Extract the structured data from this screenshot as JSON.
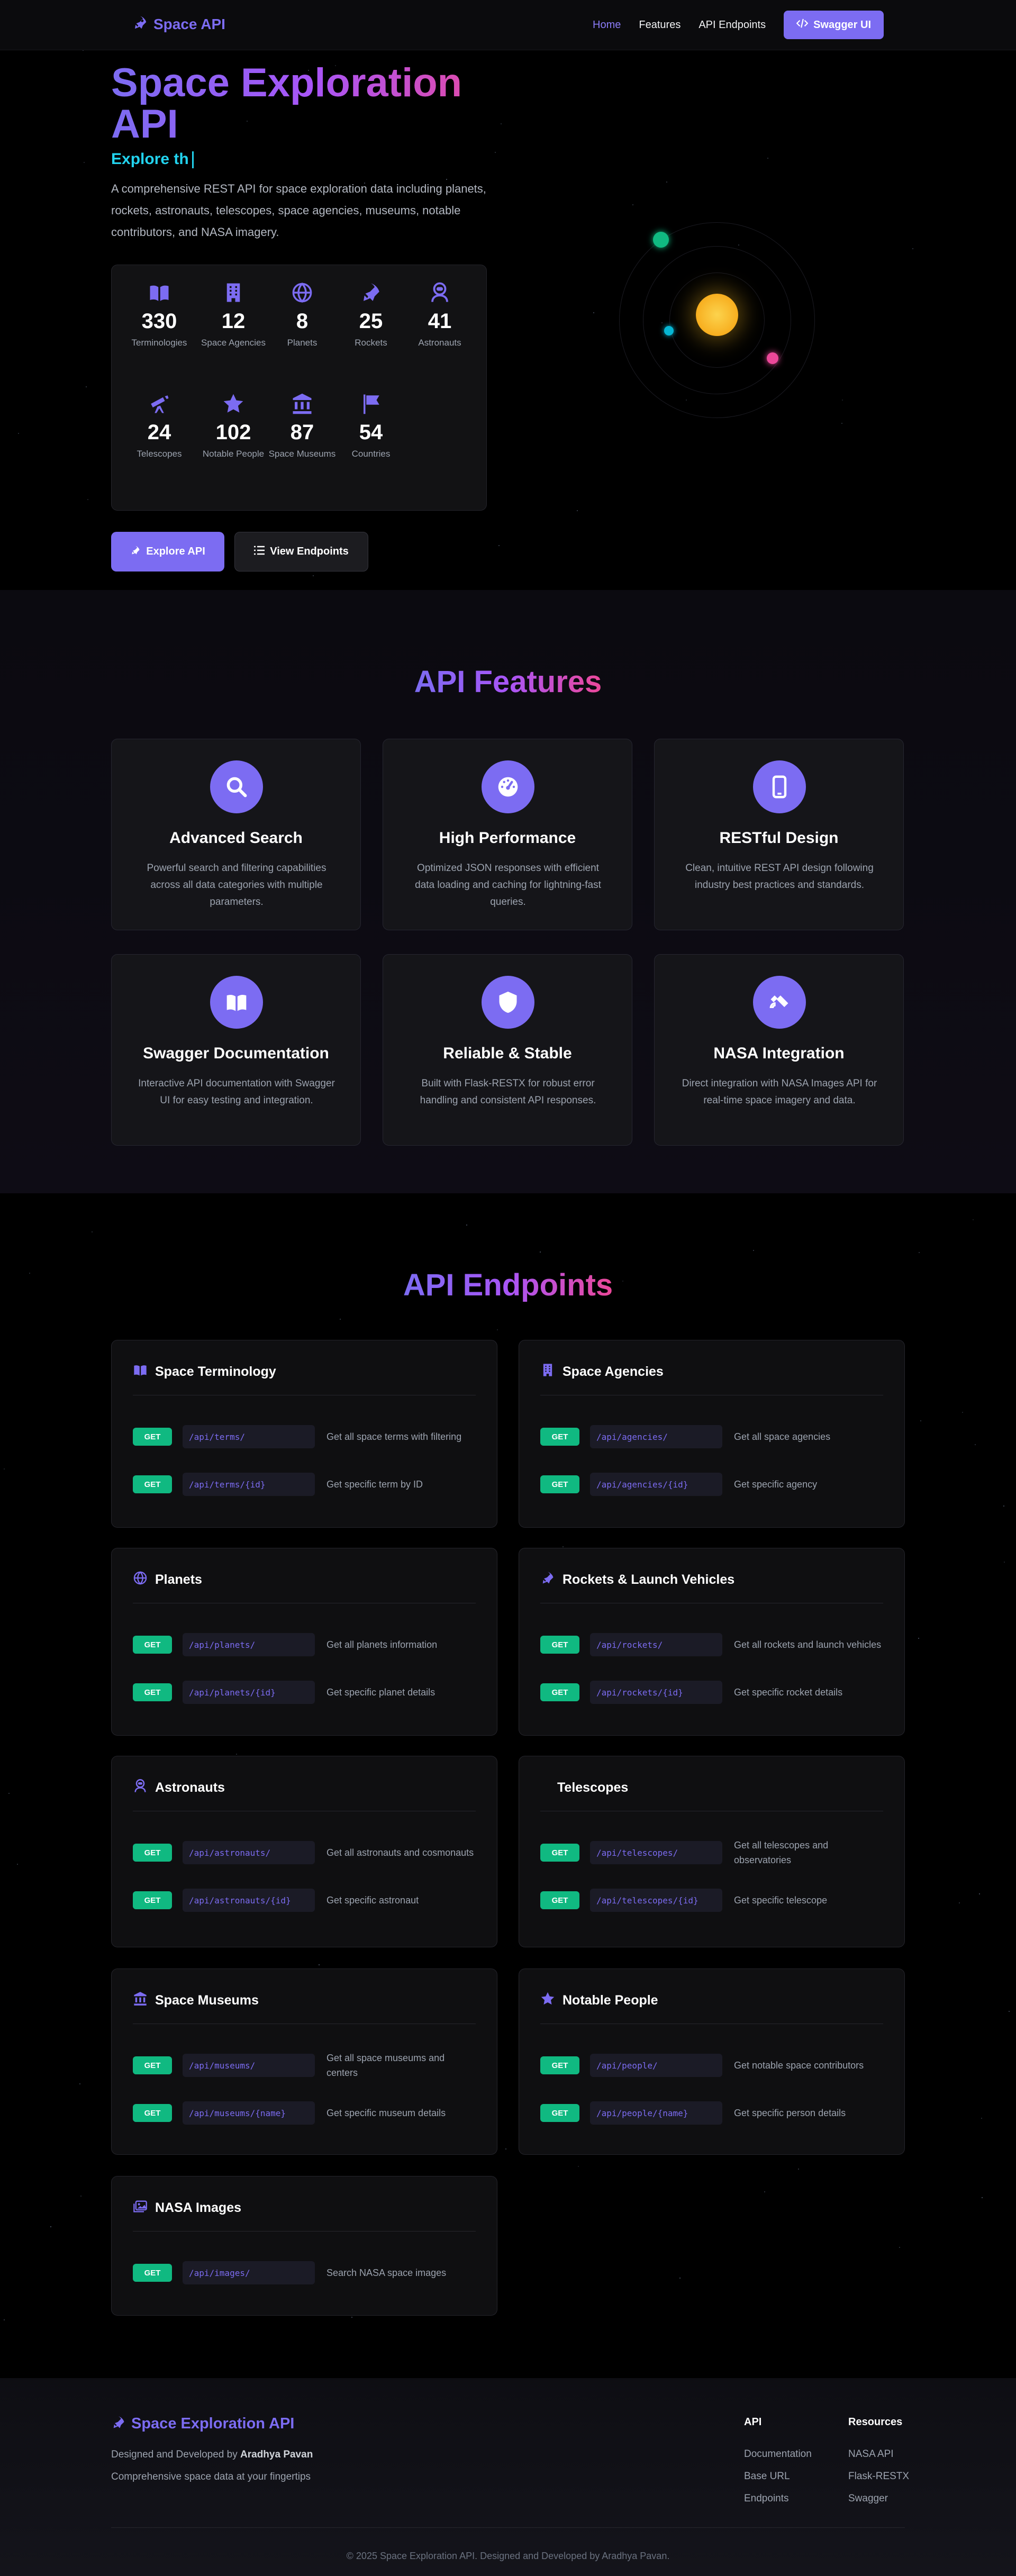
{
  "nav": {
    "brand": "Space API",
    "links": [
      "Home",
      "Features",
      "API Endpoints"
    ],
    "swagger_label": "Swagger UI"
  },
  "hero": {
    "title_line1": "Space Exploration",
    "title_line2": "API",
    "typed_text": "Explore th",
    "description": "A comprehensive REST API for space exploration data including planets, rockets, astronauts, telescopes, space agencies, museums, notable contributors, and NASA imagery.",
    "stats": [
      {
        "icon": "book-icon",
        "value": "330",
        "label": "Terminologies"
      },
      {
        "icon": "building-icon",
        "value": "12",
        "label": "Space Agencies"
      },
      {
        "icon": "globe-icon",
        "value": "8",
        "label": "Planets"
      },
      {
        "icon": "rocket-icon",
        "value": "25",
        "label": "Rockets"
      },
      {
        "icon": "astronaut-icon",
        "value": "41",
        "label": "Astronauts"
      },
      {
        "icon": "telescope-icon",
        "value": "24",
        "label": "Telescopes"
      },
      {
        "icon": "star-icon",
        "value": "102",
        "label": "Notable People"
      },
      {
        "icon": "museum-icon",
        "value": "87",
        "label": "Space Museums"
      },
      {
        "icon": "flag-icon",
        "value": "54",
        "label": "Countries"
      }
    ],
    "explore_label": "Explore API",
    "view_label": "View Endpoints"
  },
  "features": {
    "title": "API Features",
    "items": [
      {
        "icon": "search-icon",
        "title": "Advanced Search",
        "desc": "Powerful search and filtering capabilities across all data categories with multiple parameters."
      },
      {
        "icon": "speedometer-icon",
        "title": "High Performance",
        "desc": "Optimized JSON responses with efficient data loading and caching for lightning-fast queries."
      },
      {
        "icon": "mobile-icon",
        "title": "RESTful Design",
        "desc": "Clean, intuitive REST API design following industry best practices and standards."
      },
      {
        "icon": "book-icon",
        "title": "Swagger Documentation",
        "desc": "Interactive API documentation with Swagger UI for easy testing and integration."
      },
      {
        "icon": "shield-icon",
        "title": "Reliable & Stable",
        "desc": "Built with Flask-RESTX for robust error handling and consistent API responses."
      },
      {
        "icon": "satellite-icon",
        "title": "NASA Integration",
        "desc": "Direct integration with NASA Images API for real-time space imagery and data."
      }
    ]
  },
  "endpoints": {
    "title": "API Endpoints",
    "method": "GET",
    "groups": [
      {
        "icon": "book-icon",
        "title": "Space Terminology",
        "rows": [
          {
            "path": "/api/terms/",
            "desc": "Get all space terms with filtering"
          },
          {
            "path": "/api/terms/{id}",
            "desc": "Get specific term by ID"
          }
        ]
      },
      {
        "icon": "building-icon",
        "title": "Space Agencies",
        "rows": [
          {
            "path": "/api/agencies/",
            "desc": "Get all space agencies"
          },
          {
            "path": "/api/agencies/{id}",
            "desc": "Get specific agency"
          }
        ]
      },
      {
        "icon": "globe-icon",
        "title": "Planets",
        "rows": [
          {
            "path": "/api/planets/",
            "desc": "Get all planets information"
          },
          {
            "path": "/api/planets/{id}",
            "desc": "Get specific planet details"
          }
        ]
      },
      {
        "icon": "rocket-icon",
        "title": "Rockets & Launch Vehicles",
        "rows": [
          {
            "path": "/api/rockets/",
            "desc": "Get all rockets and launch vehicles"
          },
          {
            "path": "/api/rockets/{id}",
            "desc": "Get specific rocket details"
          }
        ]
      },
      {
        "icon": "astronaut-icon",
        "title": "Astronauts",
        "rows": [
          {
            "path": "/api/astronauts/",
            "desc": "Get all astronauts and cosmonauts"
          },
          {
            "path": "/api/astronauts/{id}",
            "desc": "Get specific astronaut"
          }
        ]
      },
      {
        "icon": "",
        "title": "Telescopes",
        "rows": [
          {
            "path": "/api/telescopes/",
            "desc": "Get all telescopes and observatories"
          },
          {
            "path": "/api/telescopes/{id}",
            "desc": "Get specific telescope"
          }
        ]
      },
      {
        "icon": "museum-icon",
        "title": "Space Museums",
        "rows": [
          {
            "path": "/api/museums/",
            "desc": "Get all space museums and centers"
          },
          {
            "path": "/api/museums/{name}",
            "desc": "Get specific museum details"
          }
        ]
      },
      {
        "icon": "star-icon",
        "title": "Notable People",
        "rows": [
          {
            "path": "/api/people/",
            "desc": "Get notable space contributors"
          },
          {
            "path": "/api/people/{name}",
            "desc": "Get specific person details"
          }
        ]
      },
      {
        "icon": "images-icon",
        "title": "NASA Images",
        "rows": [
          {
            "path": "/api/images/",
            "desc": "Search NASA space images"
          }
        ]
      }
    ]
  },
  "footer": {
    "brand": "Space Exploration API",
    "designed_prefix": "Designed and Developed by",
    "designer": "Aradhya Pavan",
    "tagline": "Comprehensive space data at your fingertips",
    "col_api": {
      "title": "API",
      "links": [
        "Documentation",
        "Base URL",
        "Endpoints"
      ]
    },
    "col_resources": {
      "title": "Resources",
      "links": [
        "NASA API",
        "Flask-RESTX",
        "Swagger"
      ]
    },
    "copyright": "© 2025 Space Exploration API. Designed and Developed by Aradhya Pavan."
  },
  "colors": {
    "accent": "#7c6cf2",
    "accent_pink": "#ec4899",
    "cyan": "#22d3ee",
    "get_green": "#10b981",
    "sun": "#fbbf24"
  }
}
